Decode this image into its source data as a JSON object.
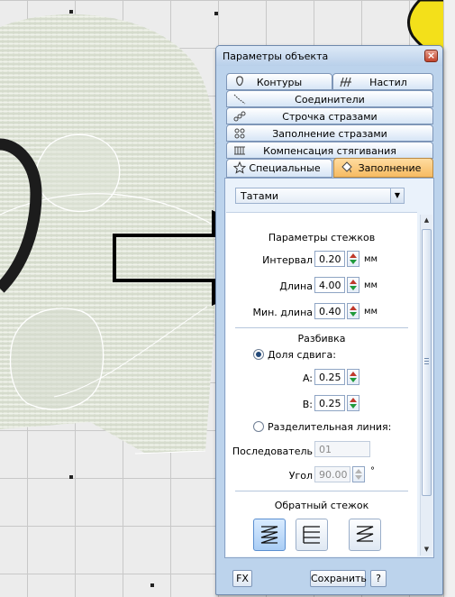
{
  "dialog": {
    "title": "Параметры объекта",
    "close_label": "×",
    "tabs": [
      {
        "label": "Контуры",
        "icon": "contour-icon"
      },
      {
        "label": "Настил",
        "icon": "tatami-fill-icon"
      },
      {
        "label": "Соединители",
        "icon": "connector-icon"
      },
      {
        "label": "Строчка стразами",
        "icon": "rhinestone-line-icon"
      },
      {
        "label": "Заполнение стразами",
        "icon": "rhinestone-fill-icon"
      },
      {
        "label": "Компенсация стягивания",
        "icon": "pull-compensation-icon"
      },
      {
        "label": "Специальные",
        "icon": "star-icon"
      },
      {
        "label": "Заполнение",
        "icon": "fill-bucket-icon",
        "active": true
      }
    ],
    "fill_type": "Татами",
    "stitch_params": {
      "heading": "Параметры стежков",
      "interval": {
        "label": "Интервал",
        "value": "0.20",
        "unit": "мм"
      },
      "length": {
        "label": "Длина",
        "value": "4.00",
        "unit": "мм"
      },
      "min_length": {
        "label": "Мин. длина",
        "value": "0.40",
        "unit": "мм"
      }
    },
    "partition": {
      "heading": "Разбивка",
      "offset_fraction_label": "Доля сдвига:",
      "a": {
        "label": "A:",
        "value": "0.25"
      },
      "b": {
        "label": "B:",
        "value": "0.25"
      },
      "dividing_line_label": "Разделительная линия:",
      "sequence": {
        "label": "Последователь",
        "value": "01"
      },
      "angle": {
        "label": "Угол",
        "value": "90.00",
        "unit": "°"
      }
    },
    "back_stitch": {
      "heading": "Обратный стежок"
    },
    "footer": {
      "fx_label": "FX",
      "save_label": "Сохранить",
      "help_label": "?"
    }
  },
  "colors": {
    "fabric": "#e7ebe0",
    "outline": "#1a1a1a",
    "yellow": "#f3e01a",
    "dialog_bg": "#bcd3ec",
    "active_tab": "#f6bb62"
  }
}
